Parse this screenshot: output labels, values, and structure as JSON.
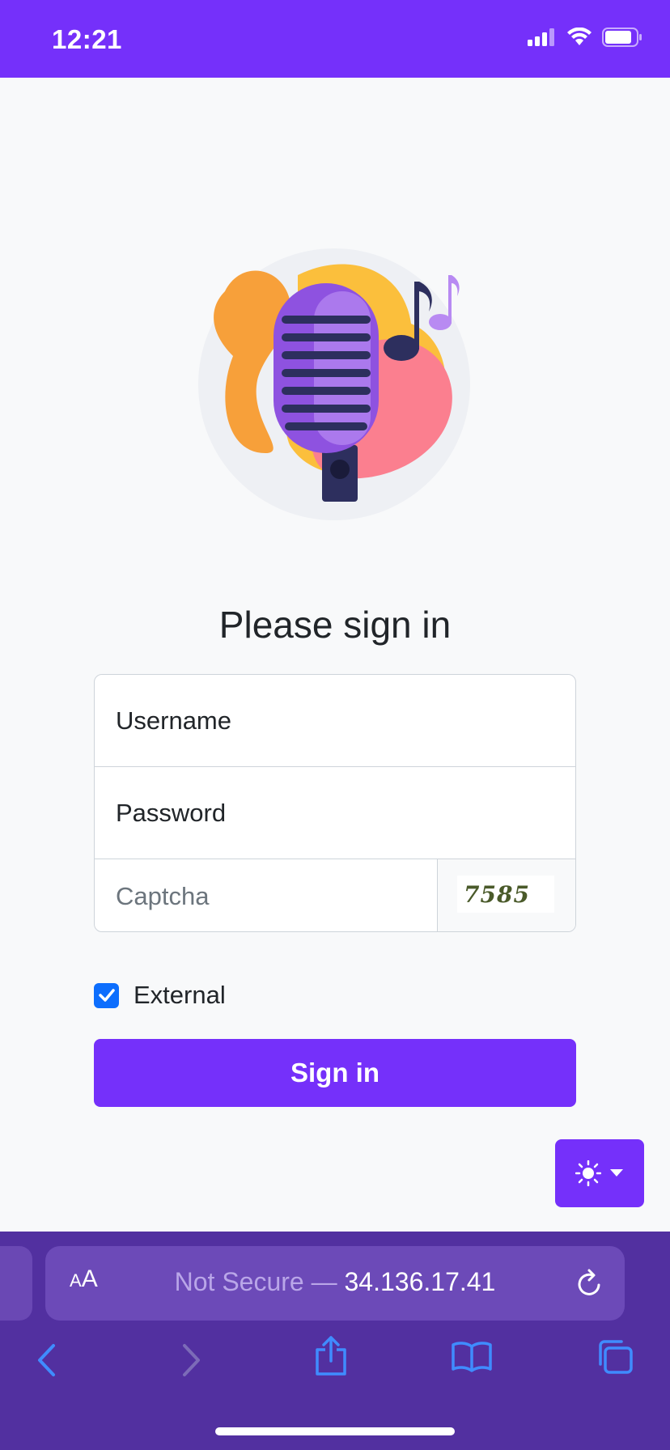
{
  "status": {
    "time": "12:21",
    "icons": [
      "cellular-signal-icon",
      "wifi-icon",
      "battery-icon"
    ]
  },
  "hero": {
    "icon": "microphone-music-illustration"
  },
  "title": "Please sign in",
  "form": {
    "username_placeholder": "Username",
    "password_placeholder": "Password",
    "captcha_placeholder": "Captcha",
    "captcha_code": "7585"
  },
  "external": {
    "label": "External",
    "checked": true
  },
  "signin_label": "Sign in",
  "theme": {
    "icon": "sun-icon",
    "dropdown_icon": "caret-down-icon"
  },
  "browser": {
    "aa_small": "A",
    "aa_large": "A",
    "url_prefix": "Not Secure — ",
    "url_host": "34.136.17.41",
    "nav_icons": [
      "back-icon",
      "forward-icon",
      "share-icon",
      "bookmarks-icon",
      "tabs-icon"
    ]
  },
  "colors": {
    "brand": "#7530fa",
    "checkbox": "#0d6efd",
    "browser_bg": "#5230a0"
  }
}
